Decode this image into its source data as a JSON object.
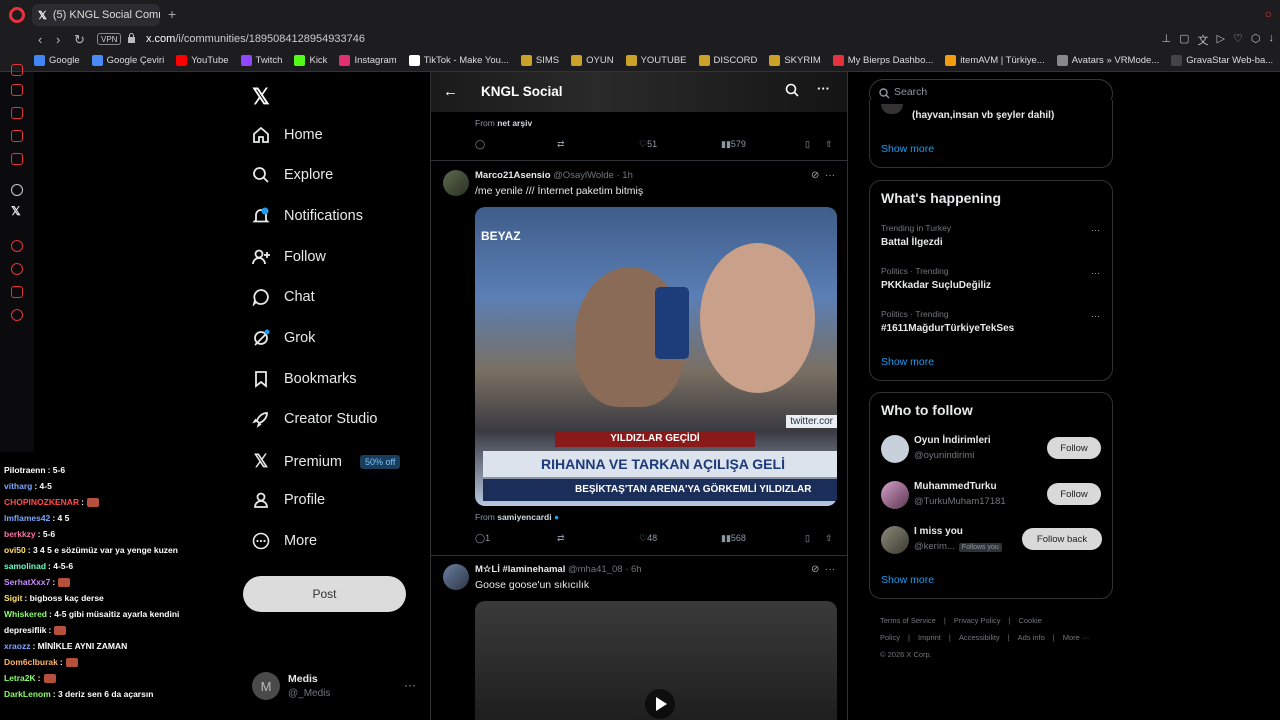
{
  "browser": {
    "tab_title": "(5) KNGL Social Communi",
    "new_tab": "+",
    "vpn": "VPN",
    "url_host": "x.com",
    "url_path": "/i/communities/1895084128954933746",
    "bookmarks": [
      "Google",
      "Google Çeviri",
      "YouTube",
      "Twitch",
      "Kick",
      "Instagram",
      "TikTok - Make You...",
      "SIMS",
      "OYUN",
      "YOUTUBE",
      "DISCORD",
      "SKYRIM",
      "My Bierps Dashbo...",
      "itemAVM | Türkiye...",
      "Avatars » VRMode...",
      "GravaStar Web-ba..."
    ]
  },
  "chat": [
    {
      "user": "Pilotraenn",
      "color": "#ffffff",
      "msg": ": 5-6"
    },
    {
      "user": "vitharg",
      "color": "#7aa7ff",
      "msg": ": 4-5"
    },
    {
      "user": "CHOPINOZKENAR",
      "color": "#ff4d4d",
      "msg": ":"
    },
    {
      "user": "lmflames42",
      "color": "#7aa7ff",
      "msg": ": 4 5"
    },
    {
      "user": "berkkzy",
      "color": "#ff6fa8",
      "msg": ": 5-6"
    },
    {
      "user": "ovi50",
      "color": "#ffe26a",
      "msg": ": 3 4 5 e sözümüz var ya yenge kuzen"
    },
    {
      "user": "samolinad",
      "color": "#6affc8",
      "msg": ": 4-5-6"
    },
    {
      "user": "SerhatXxx7",
      "color": "#c88cff",
      "msg": ":"
    },
    {
      "user": "Sigit",
      "color": "#ffe26a",
      "msg": ": bigboss kaç derse"
    },
    {
      "user": "Whiskered",
      "color": "#8aff6a",
      "msg": ": 4-5 gibi müsaitiz ayarla kendini"
    },
    {
      "user": "depresiflik",
      "color": "#ffffff",
      "msg": ":"
    },
    {
      "user": "xraozz",
      "color": "#7aa7ff",
      "msg": ": MİNİKLE AYNI ZAMAN"
    },
    {
      "user": "Dom6clburak",
      "color": "#ffb36a",
      "msg": ":"
    },
    {
      "user": "Letra2K",
      "color": "#8aff6a",
      "msg": ":"
    },
    {
      "user": "DarkLenom",
      "color": "#8aff6a",
      "msg": ": 3 deriz sen 6 da açarsın"
    }
  ],
  "nav": {
    "home": "Home",
    "explore": "Explore",
    "notifications": "Notifications",
    "follow": "Follow",
    "chat": "Chat",
    "grok": "Grok",
    "bookmarks": "Bookmarks",
    "creator_studio": "Creator Studio",
    "premium": "Premium",
    "premium_badge": "50% off",
    "profile": "Profile",
    "more": "More",
    "post": "Post"
  },
  "account": {
    "name": "Medis",
    "handle": "@_Medis",
    "avatar_letter": "M",
    "more": "···"
  },
  "main": {
    "title": "KNGL Social",
    "prev_post": {
      "from_label": "From",
      "from_name": "net arşiv",
      "likes": "51",
      "views": "579"
    },
    "post1": {
      "name": "Marco21Asensio",
      "handle": "@OsaylWolde",
      "time": "· 1h",
      "text": "/me yenile /// İnternet paketim bitmiş",
      "media_beyaz": "BEYAZ",
      "media_band1": "YILDIZLAR GEÇİDİ",
      "media_band2": "RIHANNA VE TARKAN AÇILIŞA GELİ",
      "media_band3": "BEŞİKTAŞ'TAN ARENA'YA GÖRKEMLİ YILDIZLAR",
      "media_watermark": "twitter.cor",
      "from_label": "From",
      "from_name": "samiyencardi",
      "replies": "1",
      "likes": "48",
      "views": "568"
    },
    "post2": {
      "name": "M☆Lİ #laminehamal",
      "handle": "@mha41_08",
      "time": "· 6h",
      "text": "Goose goose'un sıkıcılık"
    }
  },
  "right": {
    "search_placeholder": "Search",
    "top_card_text": "(hayvan,insan vb şeyler dahil)",
    "show_more": "Show more",
    "whats_happening": "What's happening",
    "trends": [
      {
        "context": "Trending in Turkey",
        "name": "Battal İlgezdi"
      },
      {
        "context": "Politics · Trending",
        "name": "PKKkadar SuçluDeğiliz"
      },
      {
        "context": "Politics · Trending",
        "name": "#1611MağdurTürkiyeTekSes"
      }
    ],
    "who_to_follow": "Who to follow",
    "suggestions": [
      {
        "name": "Oyun İndirimleri",
        "handle": "@oyunindirimi",
        "button": "Follow"
      },
      {
        "name": "MuhammedTurku",
        "handle": "@TurkuMuham17181",
        "button": "Follow"
      },
      {
        "name": "I miss you",
        "handle": "@kerim...",
        "button": "Follow back",
        "badge": "Follows you"
      }
    ],
    "footer": [
      "Terms of Service",
      "|",
      "Privacy Policy",
      "|",
      "Cookie Policy",
      "|",
      "Imprint",
      "|",
      "Accessibility",
      "|",
      "Ads info",
      "|",
      "More ···",
      "© 2026 X Corp."
    ]
  }
}
